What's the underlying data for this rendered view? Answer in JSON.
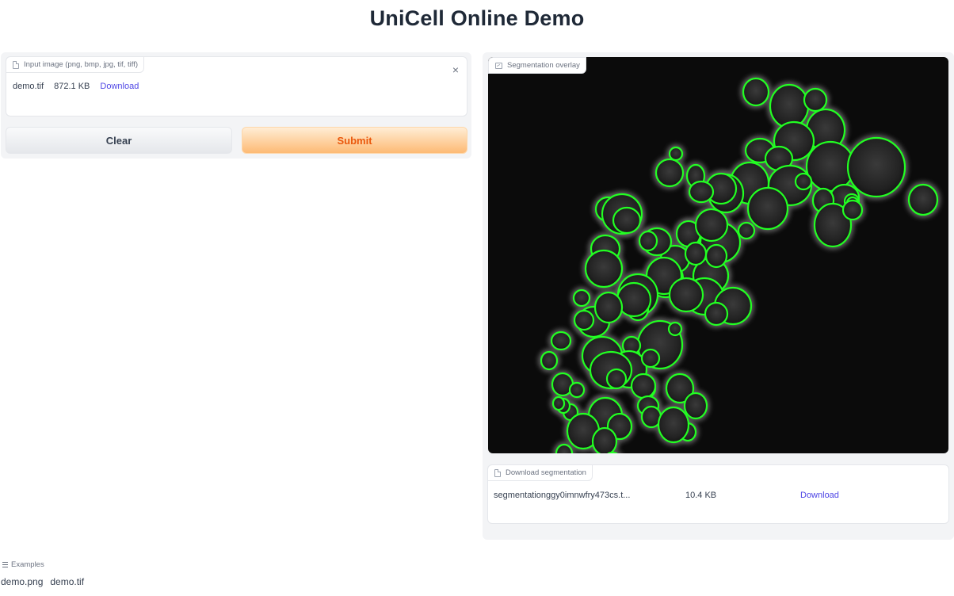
{
  "app": {
    "title": "UniCell Online Demo"
  },
  "input": {
    "label": "Input image (png, bmp, jpg, tif, tiff)",
    "file_name": "demo.tif",
    "file_size": "872.1 KB",
    "download_label": "Download",
    "close_icon": "×"
  },
  "buttons": {
    "clear": "Clear",
    "submit": "Submit"
  },
  "overlay": {
    "label": "Segmentation overlay",
    "outline_color": "#22ff22"
  },
  "download_seg": {
    "label": "Download segmentation",
    "file_name": "segmentationggy0imnwfry473cs.t...",
    "file_size": "10.4 KB",
    "download_label": "Download"
  },
  "examples": {
    "label": "Examples",
    "items": [
      "demo.png",
      "demo.tif"
    ]
  },
  "colors": {
    "accent": "#4f46e5",
    "submit_text": "#ea580c",
    "submit_bg": "#fdba74"
  }
}
